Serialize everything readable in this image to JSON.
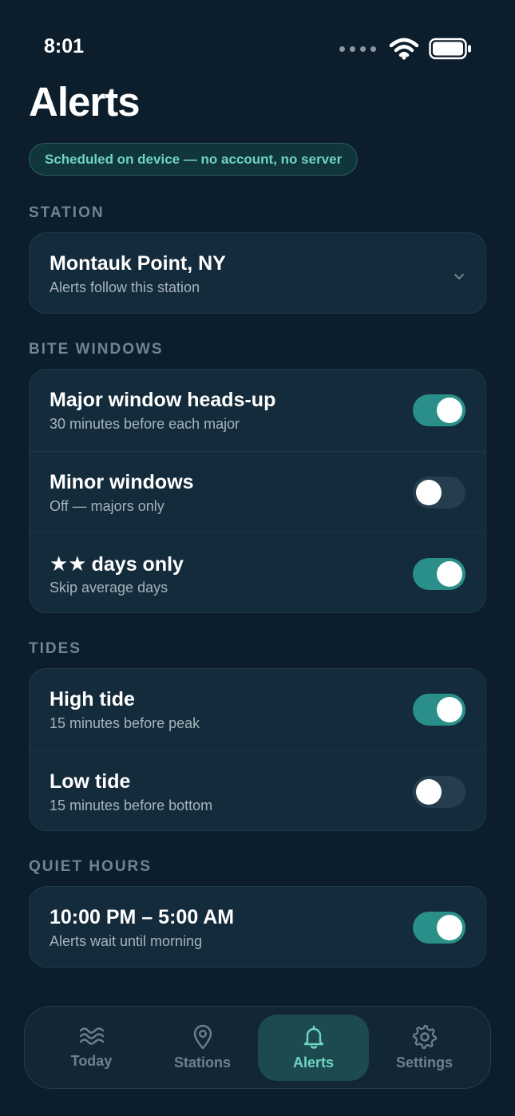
{
  "status_bar": {
    "time": "8:01"
  },
  "header": {
    "title": "Alerts",
    "badge": "Scheduled on device — no account, no server"
  },
  "station": {
    "section_label": "STATION",
    "name": "Montauk Point, NY",
    "subtitle": "Alerts follow this station"
  },
  "bite_windows": {
    "section_label": "BITE WINDOWS",
    "items": [
      {
        "title": "Major window heads-up",
        "subtitle": "30 minutes before each major",
        "on": true
      },
      {
        "title": "Minor windows",
        "subtitle": "Off — majors only",
        "on": false
      },
      {
        "title": "days only",
        "stars": "★★",
        "subtitle": "Skip average days",
        "on": true
      }
    ]
  },
  "tides": {
    "section_label": "TIDES",
    "items": [
      {
        "title": "High tide",
        "subtitle": "15 minutes before peak",
        "on": true
      },
      {
        "title": "Low tide",
        "subtitle": "15 minutes before bottom",
        "on": false
      }
    ]
  },
  "quiet_hours": {
    "section_label": "QUIET HOURS",
    "title": "10:00 PM – 5:00 AM",
    "subtitle": "Alerts wait until morning",
    "on": true
  },
  "tabbar": {
    "tabs": [
      {
        "label": "Today",
        "icon": "waves-icon",
        "active": false
      },
      {
        "label": "Stations",
        "icon": "map-pin-icon",
        "active": false
      },
      {
        "label": "Alerts",
        "icon": "bell-icon",
        "active": true
      },
      {
        "label": "Settings",
        "icon": "gear-icon",
        "active": false
      }
    ]
  },
  "colors": {
    "background": "#0c1e2b",
    "card": "#142b3b",
    "accent": "#6fd4c3",
    "toggle_on": "#2a8f89",
    "toggle_off": "#253d4c"
  }
}
